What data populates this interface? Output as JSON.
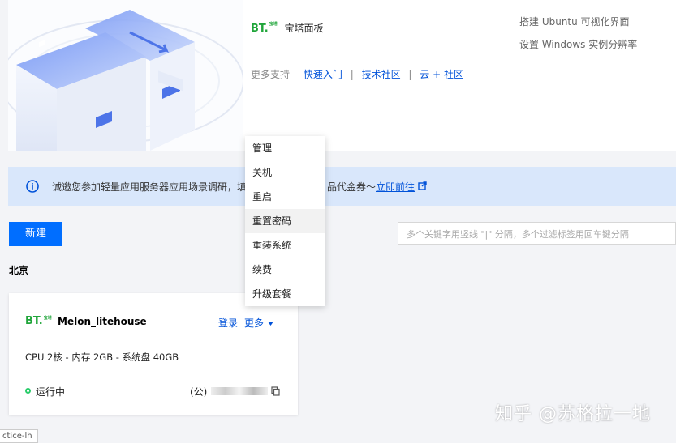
{
  "panel": {
    "product_logo": "BT.",
    "product_logo_small": "宝塔",
    "product_name": "宝塔面板",
    "more_support": "更多支持",
    "links": [
      "快速入门",
      "技术社区",
      "云 + 社区"
    ],
    "docs": [
      "搭建 Ubuntu 可视化界面",
      "设置 Windows 实例分辨率"
    ]
  },
  "notice": {
    "text": "诚邀您参加轻量应用服务器应用场景调研，填",
    "text_tail": "品代金券～",
    "link": "立即前往"
  },
  "toolbar": {
    "new_label": "新建",
    "search_placeholder": "多个关键字用竖线 \"|\" 分隔，多个过滤标签用回车键分隔"
  },
  "region": "北京",
  "instance": {
    "logo": "BT.",
    "name": "Melon_litehouse",
    "login": "登录",
    "more": "更多",
    "specs": "CPU 2核 - 内存 2GB - 系统盘 40GB",
    "status": "运行中",
    "ip_prefix": "(公)"
  },
  "menu": {
    "items": [
      "管理",
      "关机",
      "重启",
      "重置密码",
      "重装系统",
      "续费",
      "升级套餐"
    ],
    "hovered_index": 3
  },
  "watermark": "知乎 @苏格拉一地",
  "bottom_tab": "ctice-lh",
  "colors": {
    "primary": "#006eff",
    "link": "#0052d9",
    "brand_green": "#20a53a",
    "running": "#29cc6a"
  }
}
